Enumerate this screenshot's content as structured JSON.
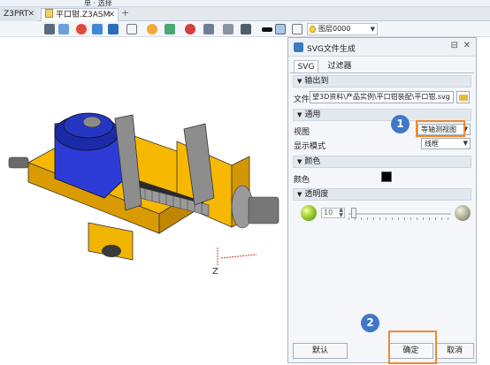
{
  "top_strip": {
    "select_label": "单 · 选择"
  },
  "tabs": [
    {
      "label": "Z3PRT",
      "active": false
    },
    {
      "label": "平口钳.Z3ASM",
      "active": true
    }
  ],
  "tab_close_glyph": "✕",
  "tab_add_glyph": "+",
  "toolbar": {
    "layer_label": "图层0000",
    "icons": [
      "toolbar-icon",
      "shade-icon",
      "color-icon",
      "view-cube-icon",
      "filter-icon",
      "render-icon",
      "grid-icon",
      "move-icon",
      "fit-icon",
      "display-icon",
      "rectangle-icon",
      "color-swatch-icon",
      "square-icon",
      "document-icon"
    ]
  },
  "viewport": {
    "axis_label": "Z"
  },
  "panel": {
    "title": "SVG文件生成",
    "pin_glyph": "⊟",
    "close_glyph": "✕",
    "tabs": [
      "SVG",
      "过滤器"
    ],
    "sections": {
      "output": "输出到",
      "general": "通用",
      "color": "颜色",
      "transparency": "透明度"
    },
    "file_label": "文件",
    "file_path": "望3D资料\\产品实例\\平口钳装配\\平口钳.svg",
    "view_label": "视图",
    "view_value": "等轴测视图",
    "display_label": "显示模式",
    "display_value": "线框",
    "color_label": "颜色",
    "color_value": "#000000",
    "transparency_value": "10",
    "transparency_fraction": 0.05,
    "buttons": {
      "default": "默认",
      "ok": "确定",
      "cancel": "取消"
    }
  },
  "annotations": {
    "step1": "1",
    "step2": "2",
    "highlight_color": "#f0892c",
    "badge_color": "#4177c9"
  }
}
